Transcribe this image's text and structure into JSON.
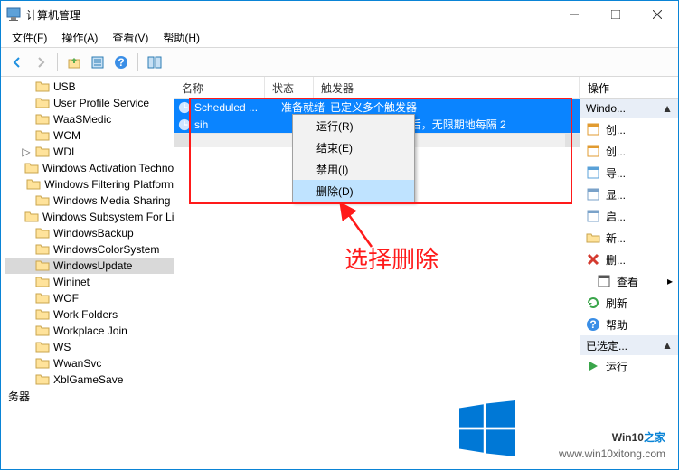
{
  "titlebar": {
    "title": "计算机管理"
  },
  "menubar": [
    "文件(F)",
    "操作(A)",
    "查看(V)",
    "帮助(H)"
  ],
  "tree": {
    "items": [
      {
        "label": "USB",
        "expander": ""
      },
      {
        "label": "User Profile Service",
        "expander": ""
      },
      {
        "label": "WaaSMedic",
        "expander": ""
      },
      {
        "label": "WCM",
        "expander": ""
      },
      {
        "label": "WDI",
        "expander": ">"
      },
      {
        "label": "Windows Activation Technologies",
        "expander": ""
      },
      {
        "label": "Windows Filtering Platform",
        "expander": ""
      },
      {
        "label": "Windows Media Sharing",
        "expander": ""
      },
      {
        "label": "Windows Subsystem For Linux",
        "expander": ""
      },
      {
        "label": "WindowsBackup",
        "expander": ""
      },
      {
        "label": "WindowsColorSystem",
        "expander": ""
      },
      {
        "label": "WindowsUpdate",
        "expander": "",
        "selected": true
      },
      {
        "label": "Wininet",
        "expander": ""
      },
      {
        "label": "WOF",
        "expander": ""
      },
      {
        "label": "Work Folders",
        "expander": ""
      },
      {
        "label": "Workplace Join",
        "expander": ""
      },
      {
        "label": "WS",
        "expander": ""
      },
      {
        "label": "WwanSvc",
        "expander": ""
      },
      {
        "label": "XblGameSave",
        "expander": ""
      }
    ],
    "footer": "务器"
  },
  "task_list": {
    "columns": [
      "名称",
      "状态",
      "触发器"
    ],
    "rows": [
      {
        "name": "Scheduled ...",
        "state": "准备就绪",
        "trigger": "已定义多个触发器"
      },
      {
        "name": "sih",
        "state": "",
        "trigger": "的 8:00 时 - 触发后，无限期地每隔 2"
      }
    ]
  },
  "context_menu": [
    "运行(R)",
    "结束(E)",
    "禁用(I)",
    "删除(D)"
  ],
  "actions": {
    "title": "操作",
    "sections": [
      {
        "label": "Windo...",
        "items": [
          {
            "icon": "new-task",
            "label": "创...",
            "color": "#e19b30"
          },
          {
            "icon": "new-basic-task",
            "label": "创...",
            "color": "#e19b30"
          },
          {
            "icon": "import",
            "label": "导...",
            "color": "#5aa1d8"
          },
          {
            "icon": "show-running",
            "label": "显...",
            "color": "#7aa2c9"
          },
          {
            "icon": "enable-history",
            "label": "启...",
            "color": "#7aa2c9"
          },
          {
            "icon": "new-folder",
            "label": "新...",
            "color": "#e5b34a"
          },
          {
            "icon": "delete",
            "label": "删...",
            "color": "#d43a2f"
          },
          {
            "icon": "view",
            "label": "查看",
            "color": "#555",
            "sub": true,
            "arrow": true
          },
          {
            "icon": "refresh",
            "label": "刷新",
            "color": "#3aa54a"
          },
          {
            "icon": "help",
            "label": "帮助",
            "color": "#3a8ee6"
          }
        ]
      },
      {
        "label": "已选定...",
        "items": [
          {
            "icon": "run",
            "label": "运行",
            "color": "#3aa54a"
          }
        ]
      }
    ]
  },
  "annotation": {
    "text": "选择删除"
  },
  "watermark": {
    "brand_prefix": "Win10",
    "brand_suffix": "之家",
    "url": "www.win10xitong.com"
  }
}
